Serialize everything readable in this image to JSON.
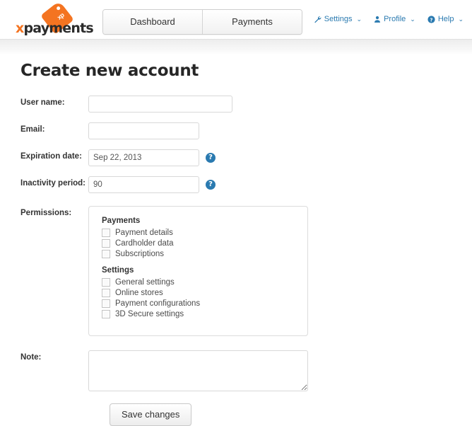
{
  "header": {
    "logo": {
      "text_x": "x",
      "text_rest": "payments",
      "tag_label": "xp"
    },
    "nav": [
      {
        "label": "Dashboard",
        "name": "nav-tab-dashboard"
      },
      {
        "label": "Payments",
        "name": "nav-tab-payments"
      }
    ],
    "user_menu": [
      {
        "label": "Settings",
        "icon": "wrench-icon",
        "caret": "⌄"
      },
      {
        "label": "Profile",
        "icon": "user-icon",
        "caret": "⌄"
      },
      {
        "label": "Help",
        "icon": "question-circle-icon",
        "caret": "⌄"
      }
    ]
  },
  "page": {
    "title": "Create new account"
  },
  "form": {
    "username": {
      "label": "User name:",
      "value": "",
      "placeholder": ""
    },
    "email": {
      "label": "Email:",
      "value": "",
      "placeholder": ""
    },
    "expiration": {
      "label": "Expiration date:",
      "value": "Sep 22, 2013",
      "help": "?"
    },
    "inactivity": {
      "label": "Inactivity period:",
      "value": "90",
      "help": "?"
    },
    "permissions": {
      "label": "Permissions:",
      "groups": [
        {
          "title": "Payments",
          "items": [
            {
              "label": "Payment details",
              "checked": false
            },
            {
              "label": "Cardholder data",
              "checked": false
            },
            {
              "label": "Subscriptions",
              "checked": false
            }
          ]
        },
        {
          "title": "Settings",
          "items": [
            {
              "label": "General settings",
              "checked": false
            },
            {
              "label": "Online stores",
              "checked": false
            },
            {
              "label": "Payment configurations",
              "checked": false
            },
            {
              "label": "3D Secure settings",
              "checked": false
            }
          ]
        }
      ]
    },
    "note": {
      "label": "Note:",
      "value": "",
      "placeholder": ""
    },
    "save_button": "Save changes"
  },
  "colors": {
    "brand_orange": "#f47421",
    "link_blue": "#2a7ab0",
    "help_blue": "#2a7ab0",
    "text": "#333333"
  }
}
